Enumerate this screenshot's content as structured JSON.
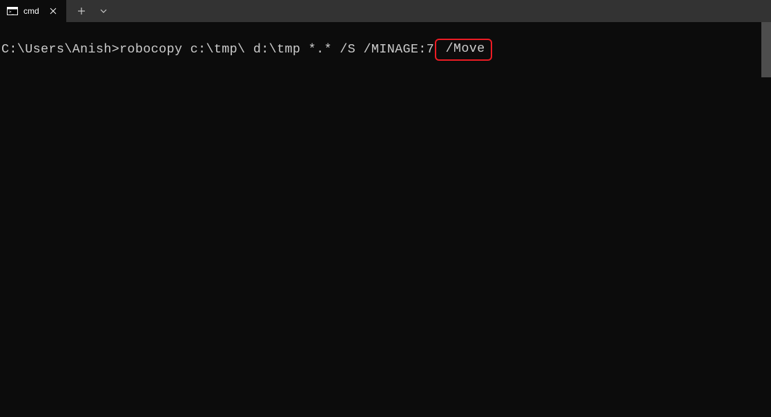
{
  "tab": {
    "label": "cmd",
    "icon_name": "terminal"
  },
  "terminal": {
    "prompt": "C:\\Users\\Anish>",
    "command_before_highlight": "robocopy c:\\tmp\\ d:\\tmp *.* /S /MINAGE:7",
    "highlighted_text": " /Move"
  },
  "highlight": {
    "color": "#ed1c24"
  }
}
